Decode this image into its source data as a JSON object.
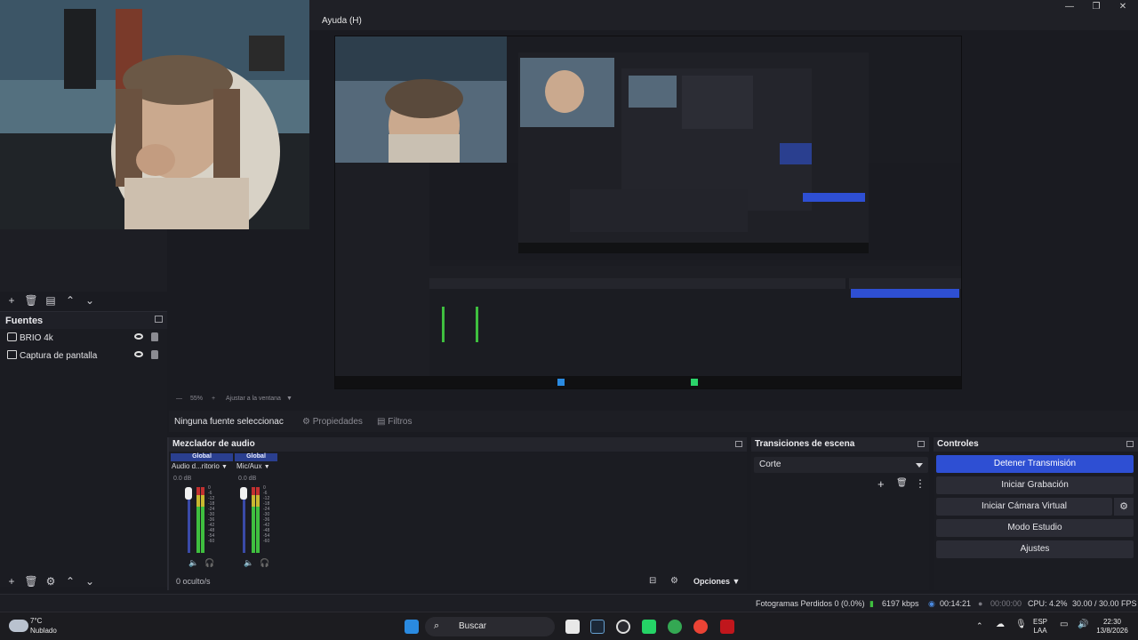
{
  "window": {
    "menu_label": "Ayuda (H)",
    "minimize": "—",
    "maximize": "❐",
    "close": "✕"
  },
  "scenes_toolbar": [
    "+",
    "🗑",
    "▤",
    "⌃",
    "⌄"
  ],
  "sources": {
    "title": "Fuentes",
    "items": [
      {
        "label": "BRIO 4k",
        "icon": "camera-icon"
      },
      {
        "label": "Captura de pantalla",
        "icon": "monitor-icon"
      }
    ],
    "toolbar": [
      "+",
      "🗑",
      "⚙",
      "⌃",
      "⌄"
    ]
  },
  "zoom_bar": {
    "zoom": "55%",
    "fit_label": "Ajustar a la ventana"
  },
  "props_row": {
    "no_source": "Ninguna fuente seleccionac",
    "properties": "Propiedades",
    "filters": "Filtros"
  },
  "mixer": {
    "title": "Mezclador de audio",
    "channels": [
      {
        "head": "Global",
        "name": "Audio d...ritorio",
        "db": "0.0 dB"
      },
      {
        "head": "Global",
        "name": "Mic/Aux",
        "db": "0.0 dB"
      }
    ],
    "scale": [
      "0",
      "-6",
      "-12",
      "-18",
      "-24",
      "-30",
      "-36",
      "-42",
      "-48",
      "-54",
      "-60"
    ],
    "hidden": "0 oculto/s",
    "options": "Opciones"
  },
  "transitions": {
    "title": "Transiciones de escena",
    "selected": "Corte"
  },
  "controls": {
    "title": "Controles",
    "buttons": [
      "Detener Transmisión",
      "Iniciar Grabación",
      "Iniciar Cámara Virtual",
      "Modo Estudio",
      "Ajustes"
    ]
  },
  "status": {
    "dropped": "Fotogramas Perdidos 0 (0.0%)",
    "bitrate": "6197 kbps",
    "stream_time": "00:14:21",
    "rec_time": "00:00:00",
    "cpu": "CPU: 4.2%",
    "fps": "30.00 / 30.00 FPS"
  },
  "taskbar": {
    "weather_temp": "7°C",
    "weather_desc": "Nublado",
    "search": "Buscar",
    "lang1": "ESP",
    "lang2": "LAA",
    "time": "22:30",
    "date": "13/8/2026"
  },
  "colors": {
    "accent": "#2e4fd3",
    "meter_green": "#3fbf3f",
    "meter_yellow": "#c8b830",
    "meter_red": "#c23030"
  }
}
